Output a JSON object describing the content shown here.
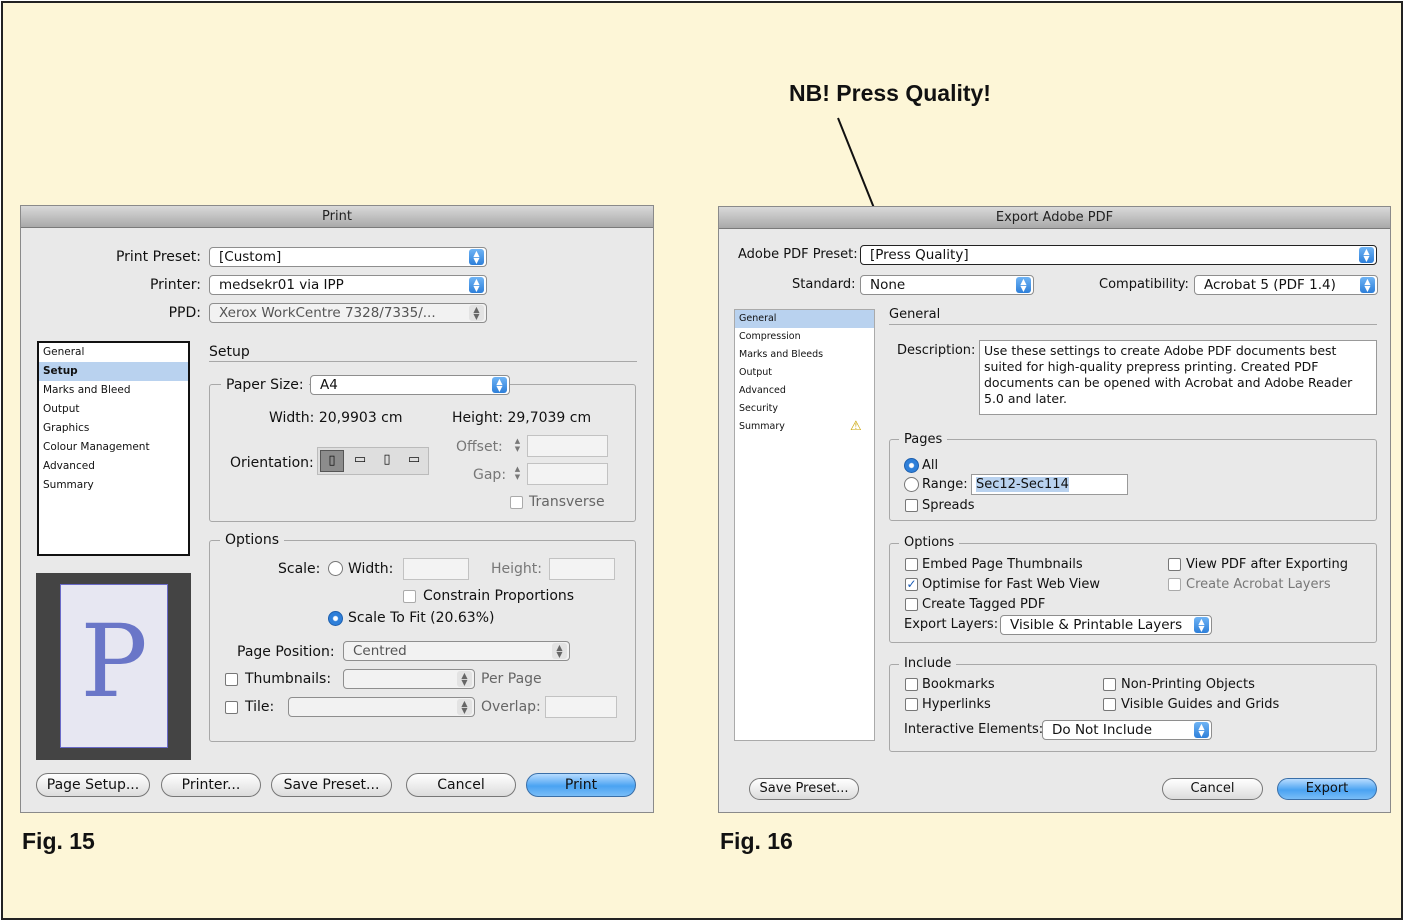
{
  "callout": {
    "text": "NB! Press Quality!"
  },
  "fig15": {
    "label": "Fig. 15",
    "title": "Print",
    "print_preset_label": "Print Preset:",
    "print_preset_value": "[Custom]",
    "printer_label": "Printer:",
    "printer_value": "medsekr01 via IPP",
    "ppd_label": "PPD:",
    "ppd_value": "Xerox WorkCentre 7328/7335/...",
    "sidebar": [
      "General",
      "Setup",
      "Marks and Bleed",
      "Output",
      "Graphics",
      "Colour Management",
      "Advanced",
      "Summary"
    ],
    "sidebar_selected": "Setup",
    "section_title": "Setup",
    "paper_size_label": "Paper Size:",
    "paper_size_value": "A4",
    "width_text": "Width: 20,9903 cm",
    "height_text": "Height: 29,7039 cm",
    "orientation_label": "Orientation:",
    "offset_label": "Offset:",
    "gap_label": "Gap:",
    "transverse_label": "Transverse",
    "options_title": "Options",
    "scale_label": "Scale:",
    "scale_width_label": "Width:",
    "scale_height_label": "Height:",
    "constrain_label": "Constrain Proportions",
    "scale_to_fit_label": "Scale To Fit (20.63%)",
    "page_position_label": "Page Position:",
    "page_position_value": "Centred",
    "thumbnails_label": "Thumbnails:",
    "per_page_label": "Per Page",
    "tile_label": "Tile:",
    "overlap_label": "Overlap:",
    "preview_letter": "P",
    "buttons": {
      "page_setup": "Page Setup...",
      "printer": "Printer...",
      "save_preset": "Save Preset...",
      "cancel": "Cancel",
      "print": "Print"
    }
  },
  "fig16": {
    "label": "Fig. 16",
    "title": "Export Adobe PDF",
    "preset_label": "Adobe PDF Preset:",
    "preset_value": "[Press Quality]",
    "standard_label": "Standard:",
    "standard_value": "None",
    "compat_label": "Compatibility:",
    "compat_value": "Acrobat 5 (PDF 1.4)",
    "sidebar": [
      "General",
      "Compression",
      "Marks and Bleeds",
      "Output",
      "Advanced",
      "Security",
      "Summary"
    ],
    "sidebar_selected": "General",
    "section_title": "General",
    "description_label": "Description:",
    "description_text": "Use these settings to create Adobe PDF documents best suited for high-quality prepress printing.  Created PDF documents can be opened with Acrobat and Adobe Reader 5.0 and later.",
    "pages_title": "Pages",
    "all_label": "All",
    "range_label": "Range:",
    "range_value": "Sec12-Sec114",
    "spreads_label": "Spreads",
    "options_title": "Options",
    "embed_thumbs_label": "Embed Page Thumbnails",
    "view_pdf_label": "View PDF after Exporting",
    "optimise_label": "Optimise for Fast Web View",
    "acrobat_layers_label": "Create Acrobat Layers",
    "tagged_label": "Create Tagged PDF",
    "export_layers_label": "Export Layers:",
    "export_layers_value": "Visible & Printable Layers",
    "include_title": "Include",
    "bookmarks_label": "Bookmarks",
    "nonprinting_label": "Non-Printing Objects",
    "hyperlinks_label": "Hyperlinks",
    "guides_label": "Visible Guides and Grids",
    "interactive_label": "Interactive Elements:",
    "interactive_value": "Do Not Include",
    "buttons": {
      "save_preset": "Save Preset...",
      "cancel": "Cancel",
      "export": "Export"
    }
  }
}
